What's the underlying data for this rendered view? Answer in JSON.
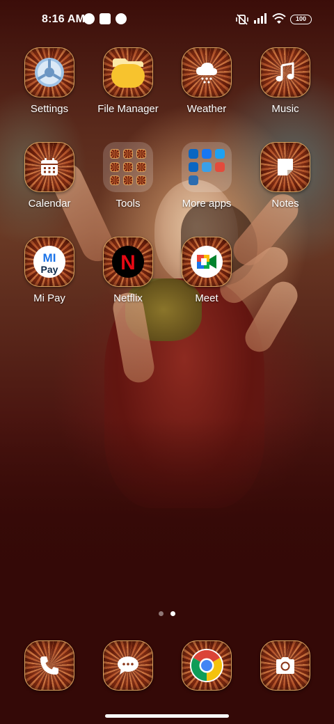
{
  "status_bar": {
    "time": "8:16 AM",
    "left_icons": [
      "circle-app-icon",
      "square-notification-icon",
      "circle-app-icon"
    ],
    "right_icons": [
      "vibrate-off-icon",
      "signal-icon",
      "wifi-icon",
      "battery-icon"
    ],
    "battery_level": "100"
  },
  "home": {
    "apps": [
      {
        "label": "Settings",
        "icon": "settings-icon"
      },
      {
        "label": "File Manager",
        "icon": "file-manager-icon"
      },
      {
        "label": "Weather",
        "icon": "weather-icon"
      },
      {
        "label": "Music",
        "icon": "music-icon"
      },
      {
        "label": "Calendar",
        "icon": "calendar-icon"
      },
      {
        "label": "Tools",
        "icon": "folder-icon"
      },
      {
        "label": "More apps",
        "icon": "folder-icon"
      },
      {
        "label": "Notes",
        "icon": "notes-icon"
      },
      {
        "label": "Mi Pay",
        "icon": "mi-pay-icon",
        "badge_text": [
          "MI",
          "Pay"
        ]
      },
      {
        "label": "Netflix",
        "icon": "netflix-icon",
        "badge_text": "N"
      },
      {
        "label": "Meet",
        "icon": "meet-icon"
      }
    ],
    "page_indicator": {
      "pages": 2,
      "current": 2
    }
  },
  "dock": [
    {
      "name": "phone",
      "icon": "phone-icon"
    },
    {
      "name": "messages",
      "icon": "message-icon"
    },
    {
      "name": "chrome",
      "icon": "chrome-icon"
    },
    {
      "name": "camera",
      "icon": "camera-icon"
    }
  ],
  "colors": {
    "tile_border": "#d7a25f",
    "file_manager_yellow": "#f7c32e",
    "netflix_red": "#e50914",
    "mi_pay_blue": "#1a73e8",
    "meet_green": "#00ac47",
    "chrome_red": "#db4437",
    "chrome_yellow": "#f4c20d",
    "chrome_green": "#0f9d58",
    "chrome_blue": "#4285f4"
  }
}
